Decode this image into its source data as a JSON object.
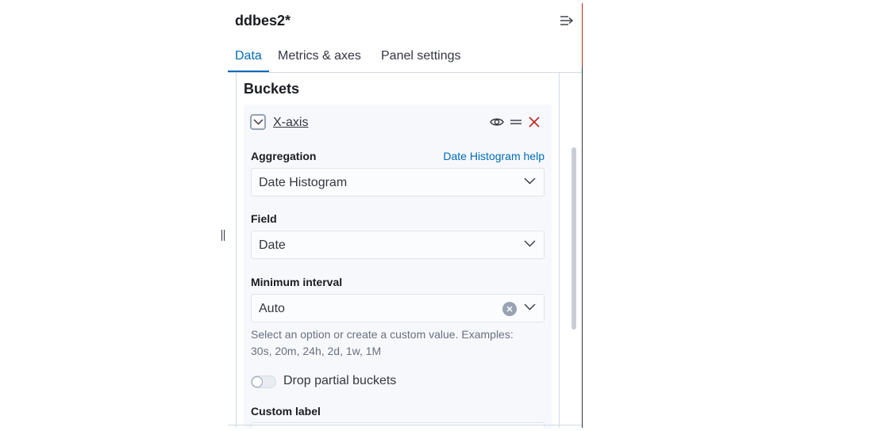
{
  "sidebar": {
    "title": "ddbes2*",
    "tabs": [
      {
        "label": "Data",
        "active": true
      },
      {
        "label": "Metrics & axes",
        "active": false
      },
      {
        "label": "Panel settings",
        "active": false
      }
    ]
  },
  "buckets": {
    "section_title": "Buckets",
    "aggregation_item": {
      "title": "X-axis",
      "aggregation_label": "Aggregation",
      "aggregation_help": "Date Histogram help",
      "aggregation_value": "Date Histogram",
      "field_label": "Field",
      "field_value": "Date",
      "interval_label": "Minimum interval",
      "interval_value": "Auto",
      "interval_help": "Select an option or create a custom value. Examples: 30s, 20m, 24h, 2d, 1w, 1M",
      "drop_partial_label": "Drop partial buckets",
      "drop_partial_enabled": false,
      "custom_label_label": "Custom label",
      "custom_label_value": ""
    }
  },
  "icons": {
    "collapse": "menu-right-icon",
    "toggle": "chevron-down-icon",
    "visibility": "eye-icon",
    "drag": "grab-icon",
    "remove": "cross-icon",
    "clear": "clear-icon"
  },
  "colors": {
    "accent": "#006bb8",
    "danger": "#bd271e",
    "text": "#343741",
    "subdued": "#69707d"
  }
}
